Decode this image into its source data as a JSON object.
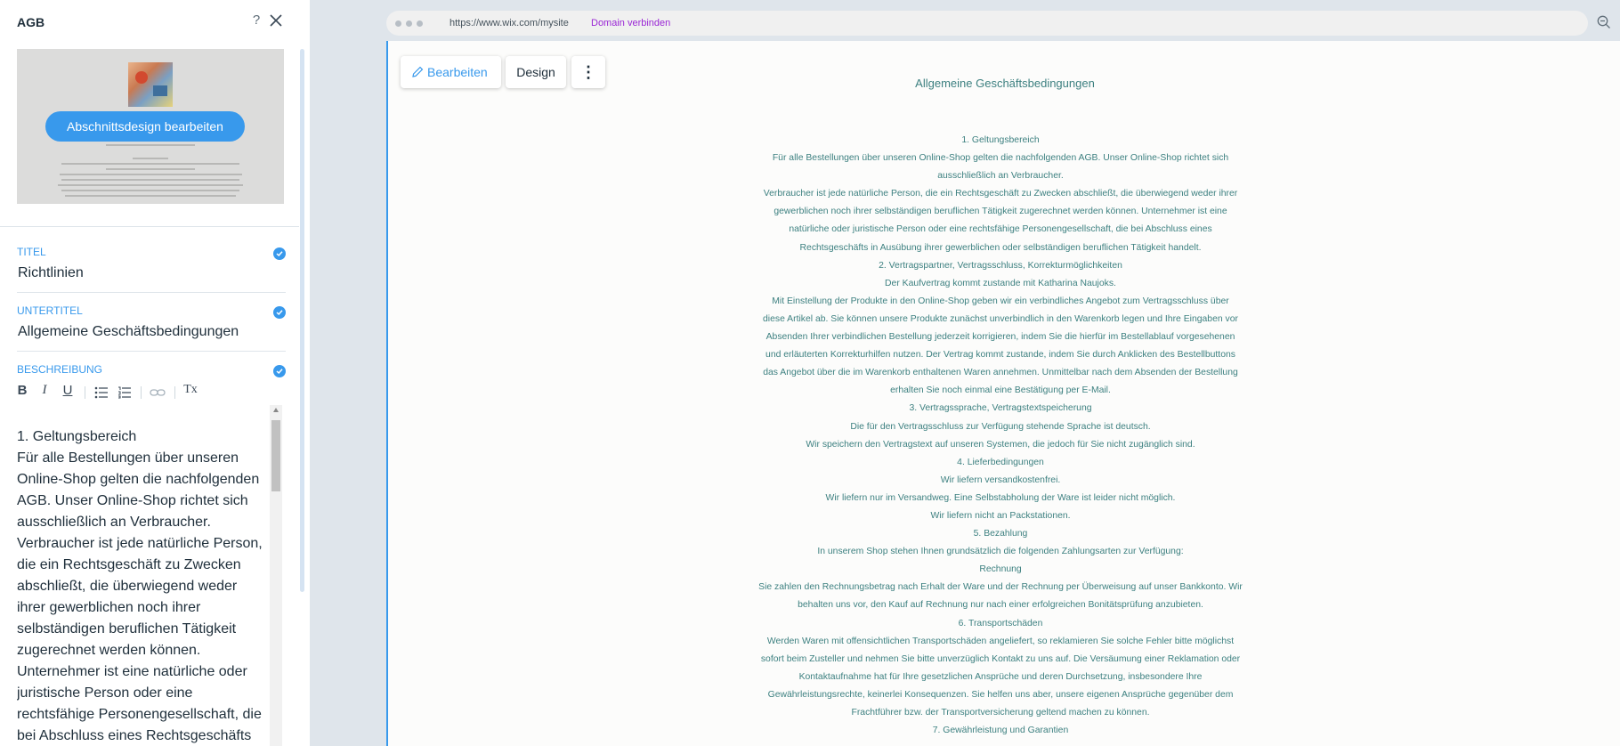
{
  "panel": {
    "title": "AGB",
    "help_label": "?",
    "preview": {
      "button_label": "Abschnittsdesign bearbeiten"
    },
    "fields": {
      "title": {
        "label": "TITEL",
        "value": "Richtlinien"
      },
      "subtitle": {
        "label": "UNTERTITEL",
        "value": "Allgemeine Geschäftsbedingungen"
      },
      "description": {
        "label": "BESCHREIBUNG"
      }
    },
    "toolbar": {
      "bold": "B",
      "italic": "I",
      "underline": "U",
      "clear": "Tx"
    },
    "rte_text": "1. Geltungsbereich\nFür alle Bestellungen über unseren\nOnline-Shop gelten die nachfolgenden\nAGB. Unser Online-Shop richtet sich\nausschließlich an Verbraucher.\nVerbraucher ist jede natürliche Person,\ndie ein Rechtsgeschäft zu Zwecken\nabschließt, die überwiegend weder\nihrer gewerblichen noch ihrer\nselbständigen beruflichen Tätigkeit\nzugerechnet werden können.\nUnternehmer ist eine natürliche oder\njuristische Person oder eine\nrechtsfähige Personengesellschaft, die\nbei Abschluss eines Rechtsgeschäfts in"
  },
  "browser": {
    "url": "https://www.wix.com/mysite",
    "connect_domain": "Domain verbinden"
  },
  "site": {
    "toolbar": {
      "edit": "Bearbeiten",
      "design": "Design",
      "more": "⋮"
    },
    "heading": "Allgemeine Geschäftsbedingungen",
    "body": "1. Geltungsbereich\nFür alle Bestellungen über unseren Online-Shop gelten die nachfolgenden AGB. Unser Online-Shop richtet sich\nausschließlich an Verbraucher.\nVerbraucher ist jede natürliche Person, die ein Rechtsgeschäft zu Zwecken abschließt, die überwiegend weder ihrer\ngewerblichen noch ihrer selbständigen beruflichen Tätigkeit zugerechnet werden können. Unternehmer ist eine\nnatürliche oder juristische Person oder eine rechtsfähige Personengesellschaft, die bei Abschluss eines\nRechtsgeschäfts in Ausübung ihrer gewerblichen oder selbständigen beruflichen Tätigkeit handelt.\n2. Vertragspartner, Vertragsschluss, Korrekturmöglichkeiten\nDer Kaufvertrag kommt zustande mit Katharina Naujoks.\nMit Einstellung der Produkte in den Online-Shop geben wir ein verbindliches Angebot zum Vertragsschluss über\ndiese Artikel ab. Sie können unsere Produkte zunächst unverbindlich in den Warenkorb legen und Ihre Eingaben vor\nAbsenden Ihrer verbindlichen Bestellung jederzeit korrigieren, indem Sie die hierfür im Bestellablauf vorgesehenen\nund erläuterten Korrekturhilfen nutzen. Der Vertrag kommt zustande, indem Sie durch Anklicken des Bestellbuttons\ndas Angebot über die im Warenkorb enthaltenen Waren annehmen. Unmittelbar nach dem Absenden der Bestellung\nerhalten Sie noch einmal eine Bestätigung per E-Mail.\n3. Vertragssprache, Vertragstextspeicherung\nDie für den Vertragsschluss zur Verfügung stehende Sprache ist deutsch.\nWir speichern den Vertragstext auf unseren Systemen, die jedoch für Sie nicht zugänglich sind.\n4. Lieferbedingungen\nWir liefern versandkostenfrei.\nWir liefern nur im Versandweg. Eine Selbstabholung der Ware ist leider nicht möglich.\nWir liefern nicht an Packstationen.\n5. Bezahlung\nIn unserem Shop stehen Ihnen grundsätzlich die folgenden Zahlungsarten zur Verfügung:\nRechnung\nSie zahlen den Rechnungsbetrag nach Erhalt der Ware und der Rechnung per Überweisung auf unser Bankkonto. Wir\nbehalten uns vor, den Kauf auf Rechnung nur nach einer erfolgreichen Bonitätsprüfung anzubieten.\n6. Transportschäden\nWerden Waren mit offensichtlichen Transportschäden angeliefert, so reklamieren Sie solche Fehler bitte möglichst\nsofort beim Zusteller und nehmen Sie bitte unverzüglich Kontakt zu uns auf. Die Versäumung einer Reklamation oder\nKontaktaufnahme hat für Ihre gesetzlichen Ansprüche und deren Durchsetzung, insbesondere Ihre\nGewährleistungsrechte, keinerlei Konsequenzen. Sie helfen uns aber, unsere eigenen Ansprüche gegenüber dem\nFrachtführer bzw. der Transportversicherung geltend machen zu können.\n7. Gewährleistung und Garantien"
  }
}
